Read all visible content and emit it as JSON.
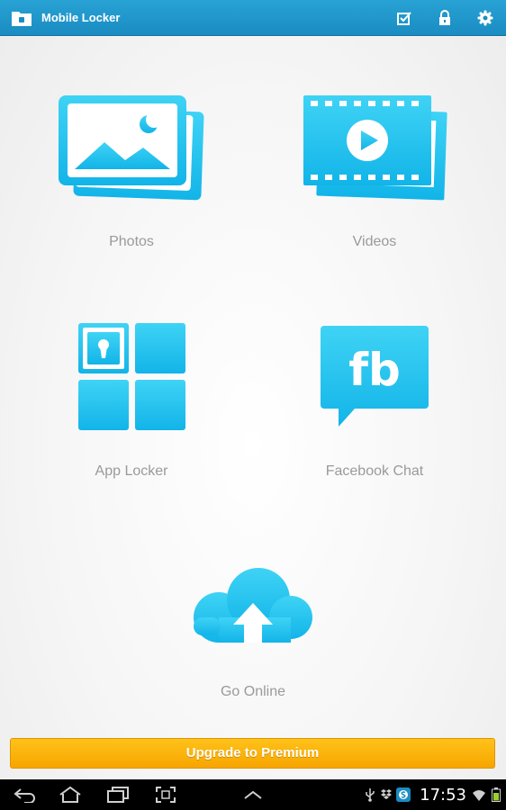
{
  "appbar": {
    "title": "Mobile Locker",
    "icons": [
      "folder-lock-icon",
      "check-icon",
      "lock-icon",
      "gear-icon"
    ]
  },
  "tiles": [
    {
      "id": "photos",
      "label": "Photos",
      "icon": "photos-icon"
    },
    {
      "id": "videos",
      "label": "Videos",
      "icon": "videos-icon"
    },
    {
      "id": "applocker",
      "label": "App Locker",
      "icon": "app-locker-icon"
    },
    {
      "id": "fbchat",
      "label": "Facebook Chat",
      "icon": "facebook-chat-icon"
    },
    {
      "id": "online",
      "label": "Go Online",
      "icon": "cloud-upload-icon"
    }
  ],
  "upgrade": {
    "label": "Upgrade to Premium"
  },
  "system_bar": {
    "nav_icons": [
      "back-icon",
      "home-icon",
      "recent-apps-icon",
      "screenshot-icon",
      "menu-up-icon"
    ],
    "status_icons": [
      "usb-icon",
      "dropbox-icon",
      "skype-icon",
      "wifi-icon",
      "battery-icon"
    ],
    "time": "17:53"
  },
  "colors": {
    "appbar": "#1a8cc2",
    "accent_cyan": "#16c0ee",
    "upgrade": "#f7a500",
    "label_gray": "#9a9a9a"
  }
}
